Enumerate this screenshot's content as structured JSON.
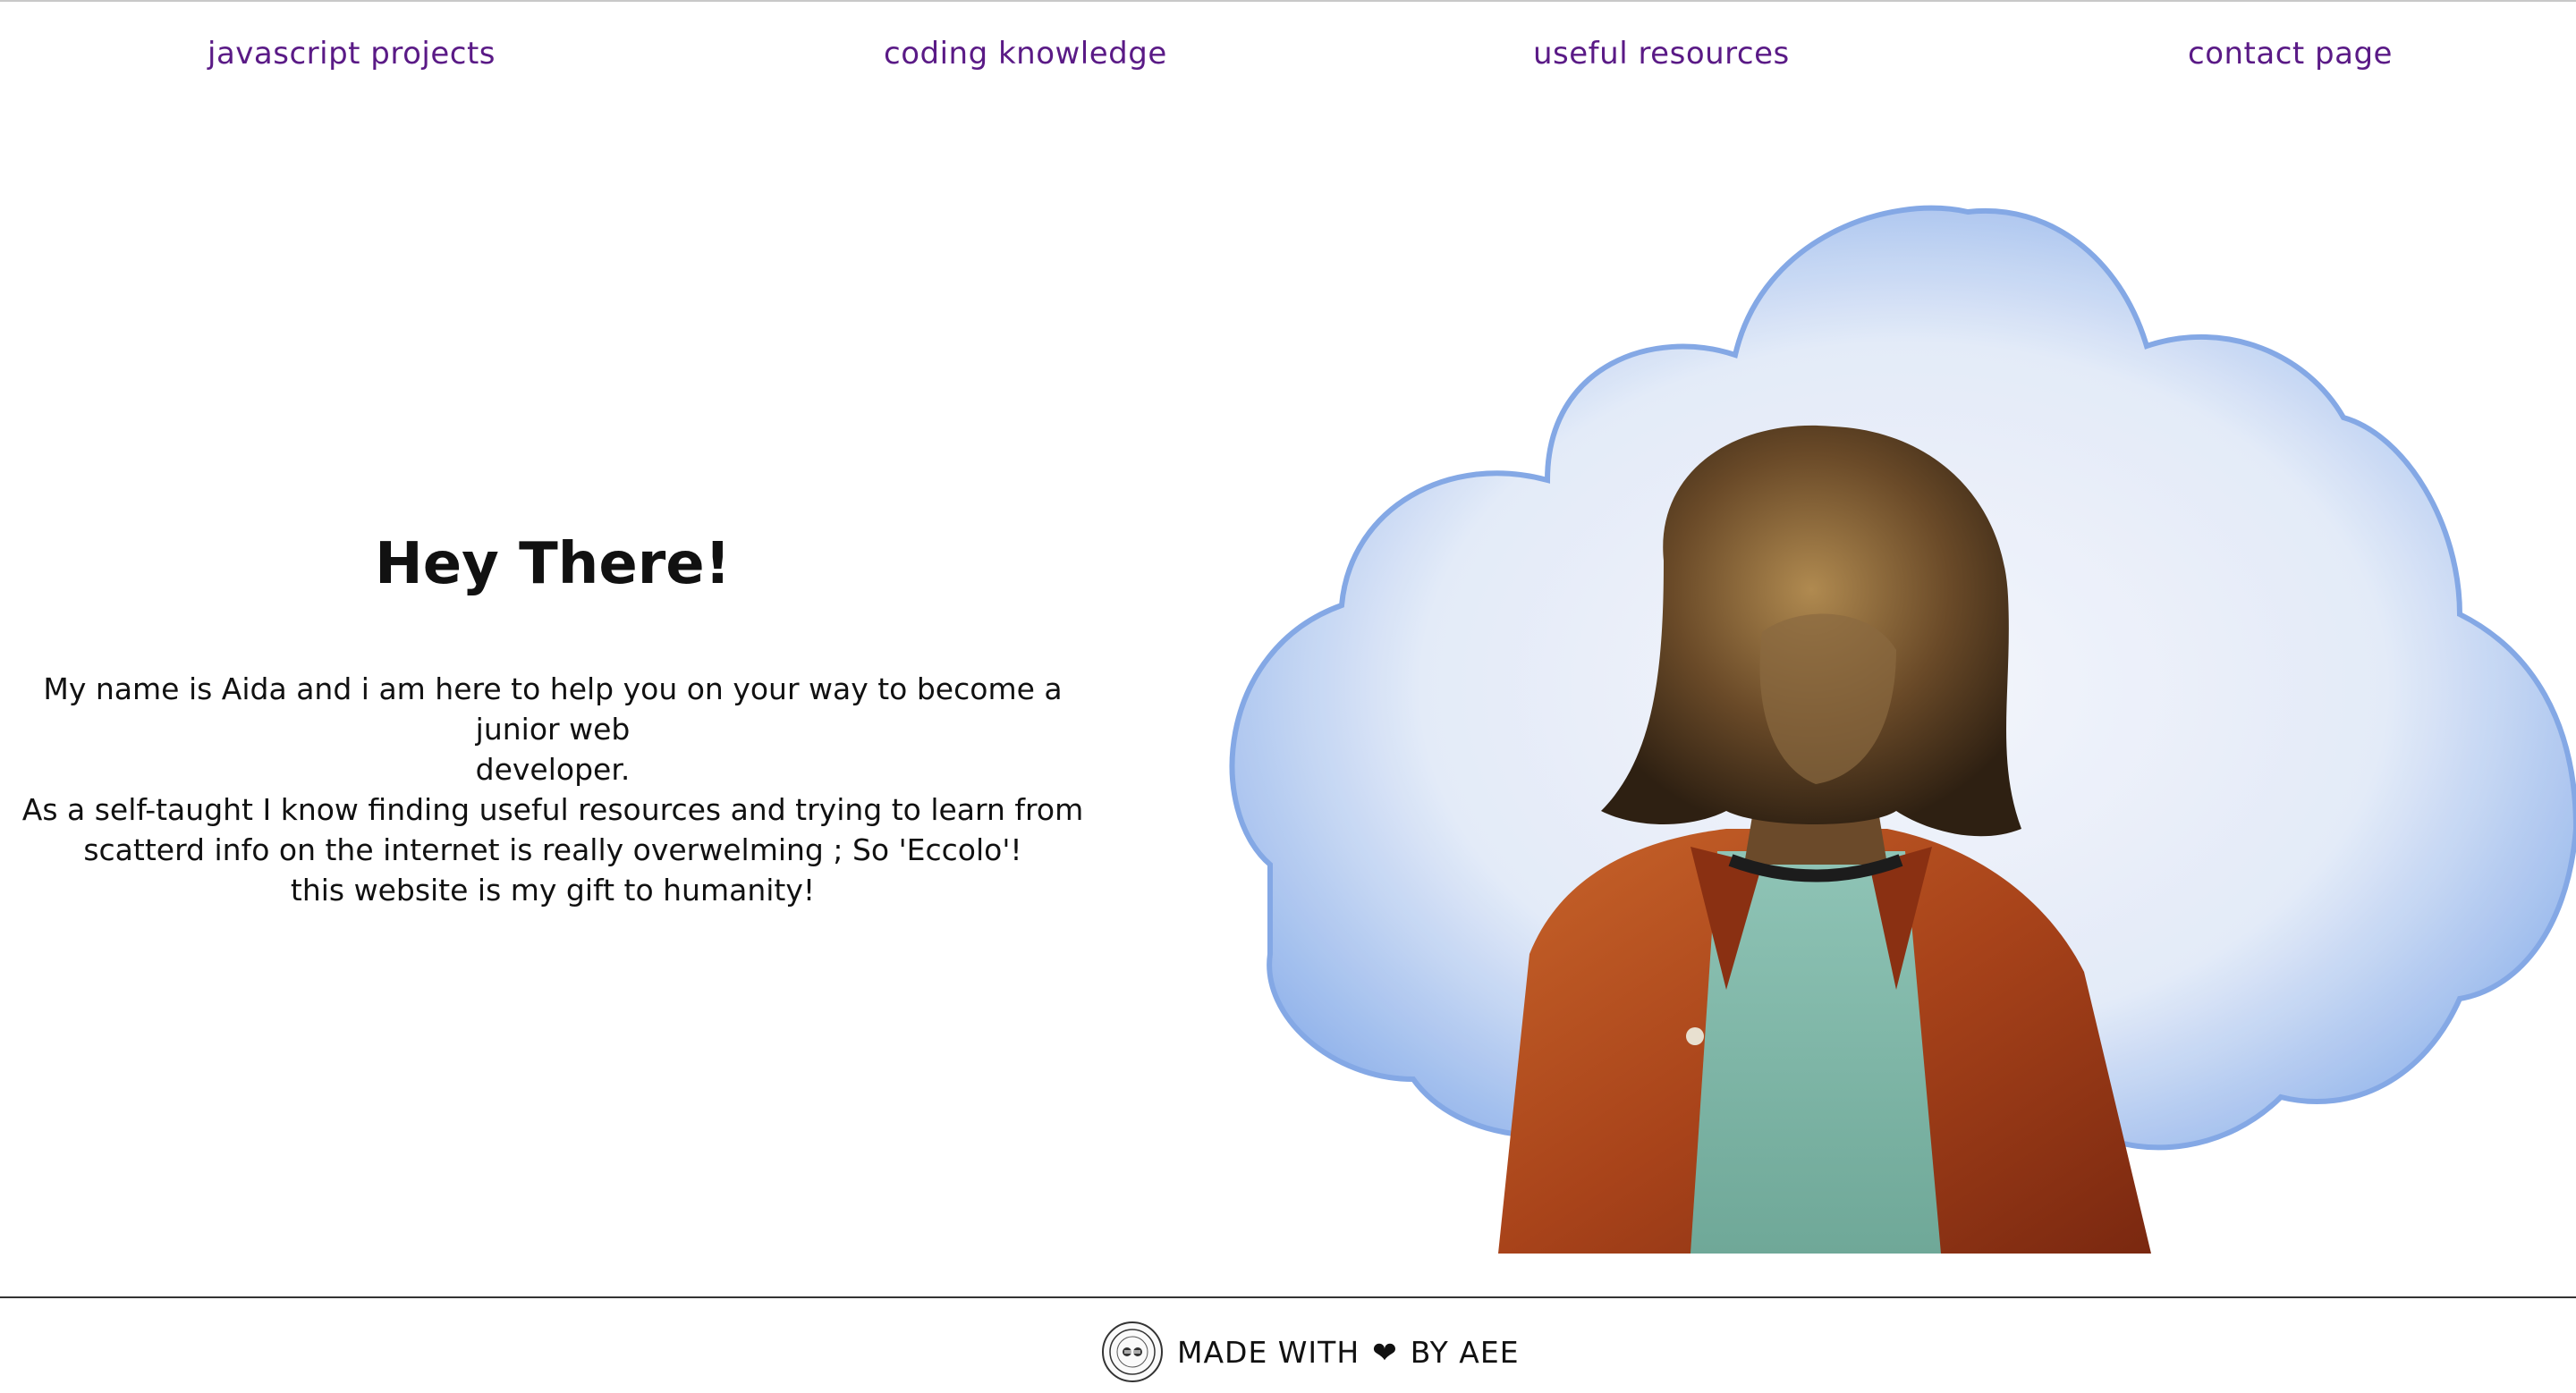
{
  "nav": {
    "items": [
      {
        "label": "javascript projects"
      },
      {
        "label": "coding knowledge"
      },
      {
        "label": "useful resources"
      },
      {
        "label": "contact page"
      }
    ]
  },
  "hero": {
    "title": "Hey There!",
    "lines": [
      "My name is Aida and i am here to help you on your way to become a junior web",
      "developer.",
      "As a self-taught I know finding useful resources and trying to learn from",
      "scatterd info on the internet is really overwelming ; So 'Eccolo'!",
      "this website is my gift to humanity!"
    ]
  },
  "footer": {
    "made_with": "MADE WITH",
    "heart": "❤",
    "by": "BY AEE"
  },
  "colors": {
    "nav_link": "#5a1a86",
    "text": "#111111",
    "cloud": "#8fb4ea"
  }
}
